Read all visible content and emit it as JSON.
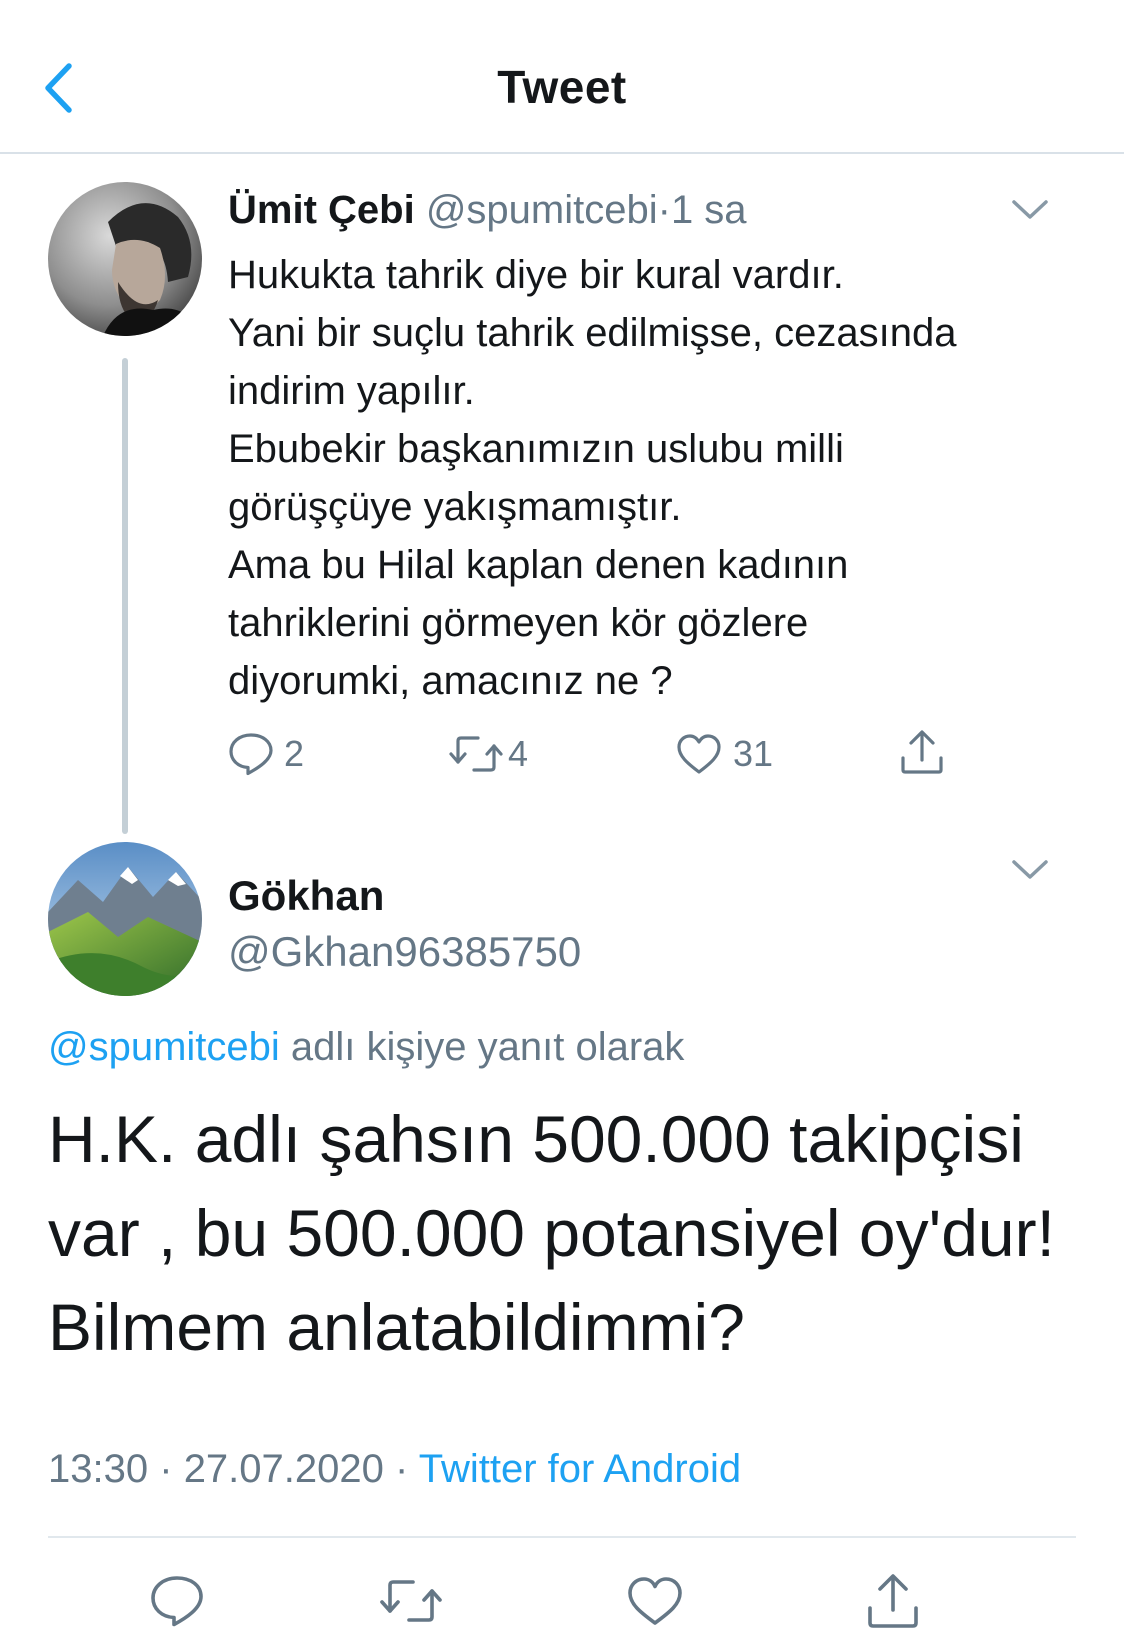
{
  "nav": {
    "title": "Tweet",
    "back_icon": "chevron-left-icon"
  },
  "colors": {
    "accent": "#1da1f2",
    "muted": "#657786",
    "text": "#14171a",
    "divider": "#e1e8ed",
    "thread_line": "#c4cfd6"
  },
  "parent_tweet": {
    "name": "Ümit Çebi",
    "handle": "@spumitcebi",
    "separator": "·",
    "time": "1 sa",
    "lines": [
      "Hukukta tahrik diye bir kural vardır.",
      "Yani bir suçlu tahrik edilmişse, cezasında",
      "indirim yapılır.",
      "Ebubekir başkanımızın uslubu milli",
      "görüşçüye yakışmamıştır.",
      "Ama bu Hilal kaplan denen kadının",
      "tahriklerini görmeyen kör gözlere",
      "diyorumki, amacınız ne ?"
    ],
    "actions": {
      "reply_count": "2",
      "retweet_count": "4",
      "like_count": "31"
    }
  },
  "reply_tweet": {
    "name": "Gökhan",
    "handle": "@Gkhan96385750",
    "reply_to_handle": "@spumitcebi",
    "reply_to_suffix": " adlı kişiye yanıt olarak",
    "lines": [
      "H.K. adlı şahsın 500.000 takipçisi",
      "var , bu 500.000 potansiyel oy'dur!",
      "Bilmem anlatabildimmi?"
    ],
    "time": "13:30",
    "date": "27.07.2020",
    "separator": "·",
    "source": "Twitter for Android"
  },
  "bottom_bar": {
    "icons": [
      "reply-icon",
      "retweet-icon",
      "like-icon",
      "share-icon"
    ]
  }
}
